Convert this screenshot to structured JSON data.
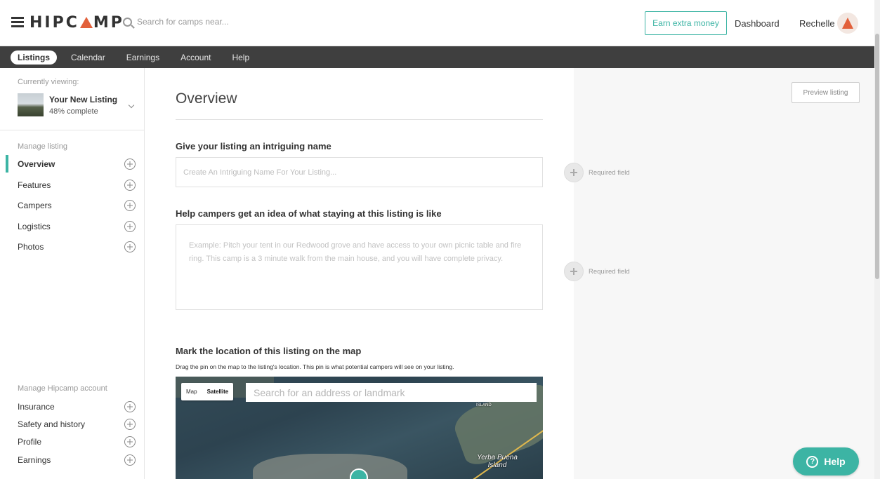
{
  "header": {
    "brand_left": "HIPC",
    "brand_right": "MP",
    "search_placeholder": "Search for camps near...",
    "earn_label": "Earn extra money",
    "dashboard_label": "Dashboard",
    "user_name": "Rechelle"
  },
  "nav": {
    "tabs": [
      {
        "label": "Listings",
        "active": true
      },
      {
        "label": "Calendar"
      },
      {
        "label": "Earnings"
      },
      {
        "label": "Account"
      },
      {
        "label": "Help"
      }
    ]
  },
  "sidebar": {
    "currently_viewing_label": "Currently viewing:",
    "listing_title": "Your New Listing",
    "listing_progress": "48% complete",
    "manage_listing_label": "Manage listing",
    "listing_items": [
      {
        "label": "Overview",
        "active": true
      },
      {
        "label": "Features"
      },
      {
        "label": "Campers"
      },
      {
        "label": "Logistics"
      },
      {
        "label": "Photos"
      }
    ],
    "manage_account_label": "Manage Hipcamp account",
    "account_items": [
      {
        "label": "Insurance"
      },
      {
        "label": "Safety and history"
      },
      {
        "label": "Profile"
      },
      {
        "label": "Earnings"
      }
    ]
  },
  "main": {
    "title": "Overview",
    "name_label": "Give your listing an intriguing name",
    "name_placeholder": "Create An Intriguing Name For Your Listing...",
    "desc_label": "Help campers get an idea of what staying at this listing is like",
    "desc_placeholder": "Example: Pitch your tent in our Redwood grove and have access to your own picnic table and fire ring. This camp is a 3 minute walk from the main house, and you will have complete privacy.",
    "map_label": "Mark the location of this listing on the map",
    "map_help": "Drag the pin on the map to the listing's location. This pin is what potential campers will see on your listing.",
    "map_type_map": "Map",
    "map_type_satellite": "Satellite",
    "map_search_placeholder": "Search for an address or landmark",
    "map_place_1": "Yerba Buena Island",
    "map_place_2": "ISLAND"
  },
  "right": {
    "preview_label": "Preview listing",
    "required_1": "Required field",
    "required_2": "Required field",
    "help_label": "Help"
  },
  "colors": {
    "accent": "#3cb4a4",
    "brand": "#e2603b",
    "navbar": "#3f3f3f"
  }
}
